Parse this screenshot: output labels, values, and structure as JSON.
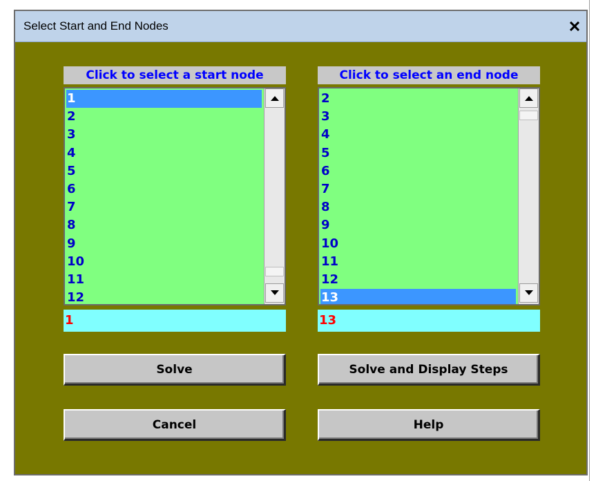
{
  "dialog": {
    "title": "Select Start and End Nodes",
    "close_glyph": "✕"
  },
  "start_list": {
    "header": "Click to select a start node",
    "items": [
      "1",
      "2",
      "3",
      "4",
      "5",
      "6",
      "7",
      "8",
      "9",
      "10",
      "11",
      "12"
    ],
    "selected": "1"
  },
  "end_list": {
    "header": "Click to select an end node",
    "items": [
      "2",
      "3",
      "4",
      "5",
      "6",
      "7",
      "8",
      "9",
      "10",
      "11",
      "12",
      "13"
    ],
    "selected": "13"
  },
  "start_selection": "1",
  "end_selection": "13",
  "buttons": {
    "solve": "Solve",
    "solve_steps": "Solve and Display Steps",
    "cancel": "Cancel",
    "help": "Help"
  },
  "colors": {
    "dialog_bg": "#787800",
    "list_bg": "#80ff80",
    "selection_field_bg": "#80ffff",
    "selected_item_bg": "#3c96ff",
    "header_text": "#0000ff",
    "selection_text": "#ff0000"
  },
  "icons": {
    "close": "close-icon",
    "scroll_up": "arrow-up-icon",
    "scroll_down": "arrow-down-icon"
  }
}
